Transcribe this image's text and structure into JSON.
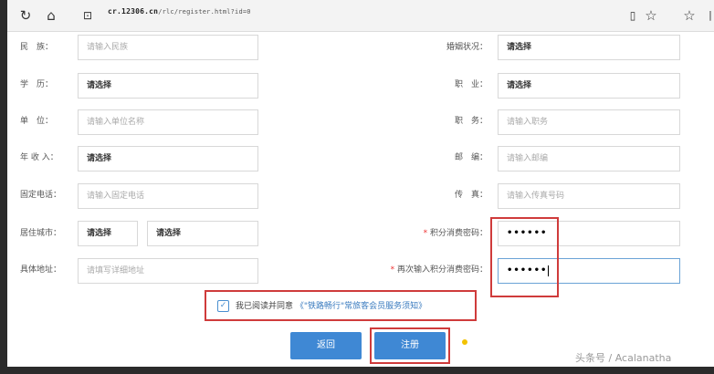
{
  "browser": {
    "url_host": "cr.12306.cn",
    "url_path": "/rlc/register.html?id=0",
    "icons": [
      "refresh-icon",
      "home-icon",
      "lock-icon",
      "reading-view-icon",
      "favorite-star-icon",
      "favorites-bar-icon"
    ]
  },
  "form": {
    "ethnicity": {
      "label": "民　族：",
      "placeholder": "请输入民族"
    },
    "marital": {
      "label": "婚姻状况：",
      "value": "请选择"
    },
    "education": {
      "label": "学　历：",
      "value": "请选择"
    },
    "occupation": {
      "label": "职　业：",
      "value": "请选择"
    },
    "employer": {
      "label": "单　位：",
      "placeholder": "请输入单位名称"
    },
    "position": {
      "label": "职　务：",
      "placeholder": "请输入职务"
    },
    "income": {
      "label": "年 收 入：",
      "value": "请选择"
    },
    "postcode": {
      "label": "邮　编：",
      "placeholder": "请输入邮编"
    },
    "phone": {
      "label": "固定电话：",
      "placeholder": "请输入固定电话"
    },
    "fax": {
      "label": "传　真：",
      "placeholder": "请输入传真号码"
    },
    "city": {
      "label": "居住城市：",
      "province": "请选择",
      "city": "请选择"
    },
    "points_password": {
      "label": "积分消费密码：",
      "required_mark": "*",
      "value": "••••••"
    },
    "address": {
      "label": "具体地址：",
      "placeholder": "请填写详细地址"
    },
    "points_password_confirm": {
      "label": "再次输入积分消费密码：",
      "required_mark": "*",
      "value": "••••••"
    }
  },
  "agreement": {
    "checked": true,
    "check_mark": "✓",
    "text": "我已阅读并同意",
    "link": "《\"铁路畅行\"常旅客会员服务须知》"
  },
  "buttons": {
    "back": "返回",
    "register": "注册"
  },
  "watermark": "头条号 / Acalanatha",
  "colors": {
    "highlight": "#cf3b3b",
    "button": "#3f88d4",
    "link": "#3a7bbf"
  }
}
